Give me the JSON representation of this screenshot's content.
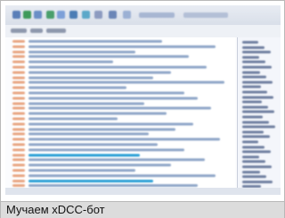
{
  "caption": "Мучаем xDCC-бот",
  "colors": {
    "message_text": "#8fa6c8",
    "timestamp": "#e8a582",
    "highlight": "#2a9fd6",
    "nick": "#6f7fa0"
  }
}
